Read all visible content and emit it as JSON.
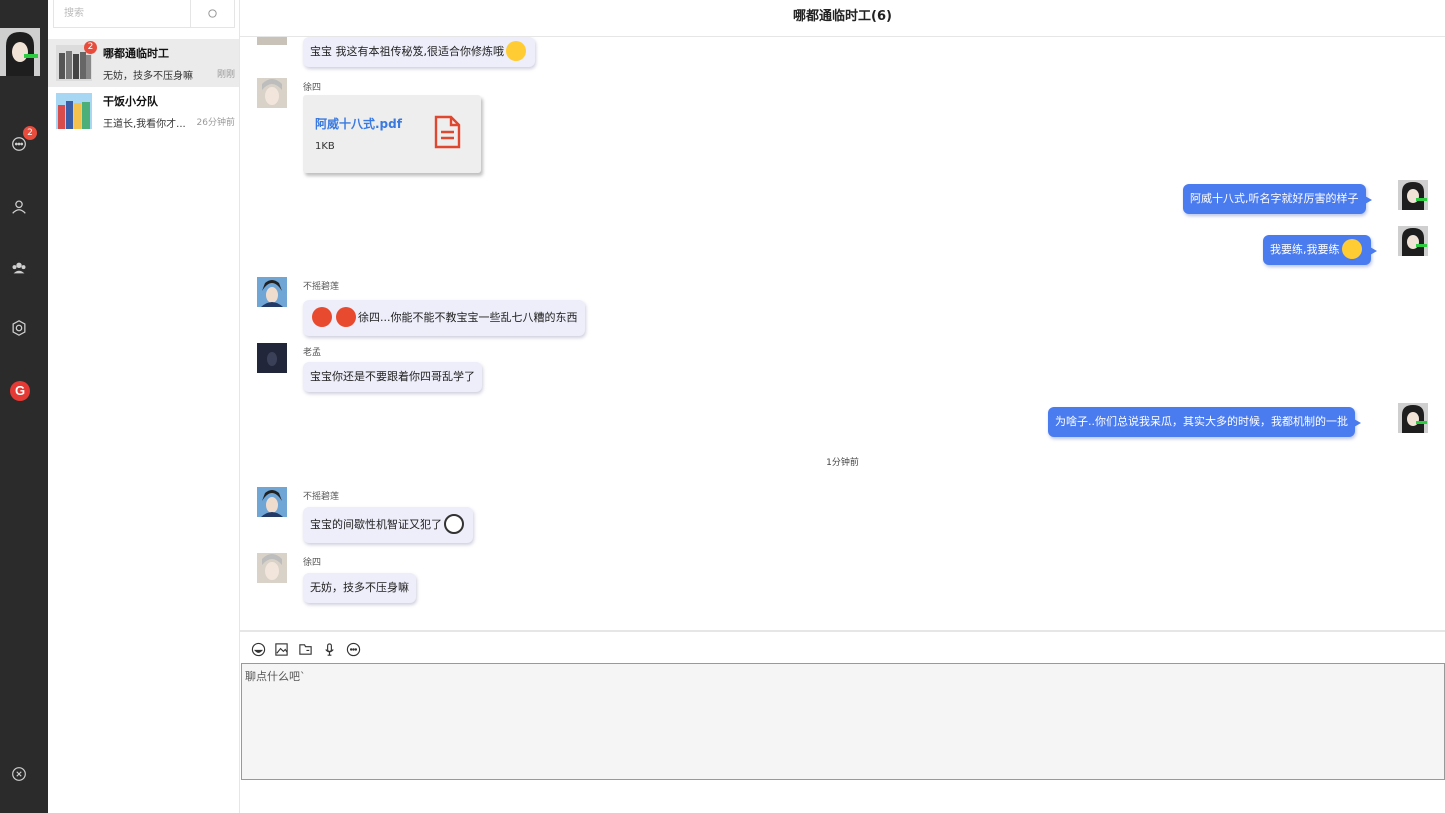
{
  "colors": {
    "nav_bg": "#2b2b2b",
    "badge": "#e74c3c",
    "my_bubble": "#4a7bef",
    "other_bubble": "#eeeefa",
    "file_link": "#3a7ae0",
    "file_icon": "#e0472f"
  },
  "nav": {
    "chat_badge": "2"
  },
  "search": {
    "placeholder": "搜索"
  },
  "contacts": [
    {
      "name": "哪都通临时工",
      "last": "无妨，技多不压身嘛",
      "time": "刚刚",
      "badge": "2"
    },
    {
      "name": "干饭小分队",
      "last": "王道长,我看你才...",
      "time": "26分钟前"
    }
  ],
  "chat": {
    "title": "哪都通临时工(6)",
    "m1": {
      "text": "宝宝 我这有本祖传秘笈,很适合你修炼哦"
    },
    "m2": {
      "sender": "徐四",
      "file_name": "阿威十八式.pdf",
      "file_size": "1KB"
    },
    "m3": {
      "text": "阿威十八式,听名字就好厉害的样子"
    },
    "m4": {
      "text": "我要练,我要练"
    },
    "m5": {
      "sender": "不摇碧莲",
      "text": "徐四...你能不能不教宝宝一些乱七八糟的东西"
    },
    "m6": {
      "sender": "老孟",
      "text": "宝宝你还是不要跟着你四哥乱学了"
    },
    "m7": {
      "text": "为啥子..你们总说我呆瓜，其实大多的时候，我都机制的一批"
    },
    "divider": "1分钟前",
    "m8": {
      "sender": "不摇碧莲",
      "text": "宝宝的间歇性机智证又犯了"
    },
    "m9": {
      "sender": "徐四",
      "text": "无妨，技多不压身嘛"
    }
  },
  "input": {
    "placeholder": "聊点什么吧`"
  }
}
